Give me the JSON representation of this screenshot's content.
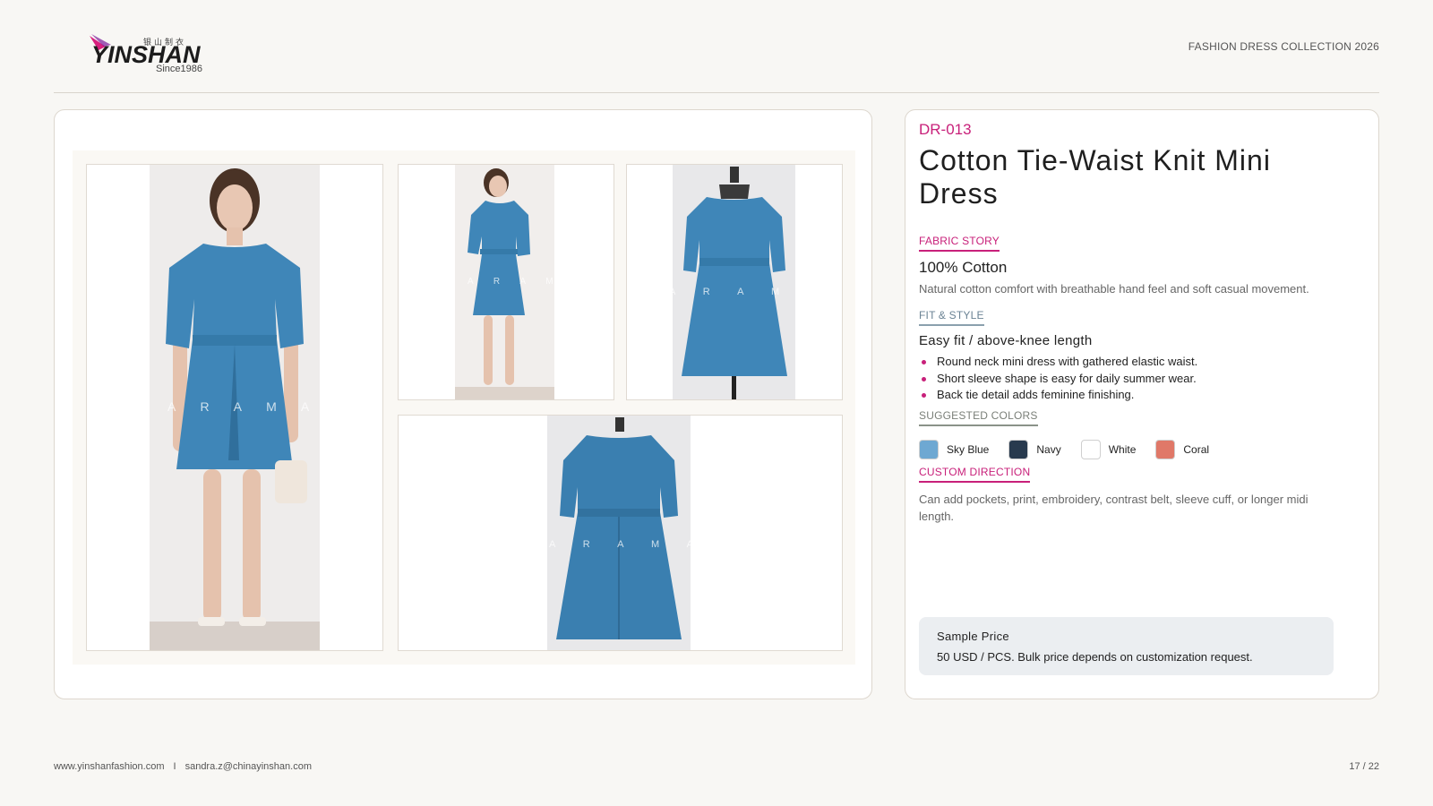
{
  "brand": {
    "chinese_name": "银山制衣",
    "wordmark": "YINSHAN",
    "since": "Since1986"
  },
  "header": {
    "collection": "FASHION DRESS COLLECTION 2026"
  },
  "gallery": {
    "watermark": "A R A M A R C",
    "photos": [
      {
        "view": "front-model"
      },
      {
        "view": "side-model"
      },
      {
        "view": "front-mannequin"
      },
      {
        "view": "back-mannequin"
      }
    ]
  },
  "product": {
    "code": "DR-013",
    "title": "Cotton Tie-Waist Knit Mini Dress",
    "fabric": {
      "label": "FABRIC STORY",
      "main": "100% Cotton",
      "desc": "Natural cotton comfort with breathable hand feel and soft casual movement."
    },
    "fit": {
      "label": "FIT & STYLE",
      "main": "Easy fit / above-knee length",
      "bullets": [
        "Round neck mini dress with gathered elastic waist.",
        "Short sleeve shape is easy for daily summer wear.",
        "Back tie detail adds feminine finishing."
      ]
    },
    "colors": {
      "label": "SUGGESTED COLORS",
      "items": [
        {
          "name": "Sky Blue",
          "hex": "#6ea8d2"
        },
        {
          "name": "Navy",
          "hex": "#283a4e"
        },
        {
          "name": "White",
          "hex": "#ffffff"
        },
        {
          "name": "Coral",
          "hex": "#e07868"
        }
      ]
    },
    "custom": {
      "label": "CUSTOM DIRECTION",
      "desc": "Can add pockets, print, embroidery, contrast belt, sleeve cuff, or longer midi length."
    },
    "price": {
      "label": "Sample Price",
      "text": "50 USD / PCS. Bulk price depends on customization request."
    }
  },
  "footer": {
    "website": "www.yinshanfashion.com",
    "separator": "I",
    "email": "sandra.z@chinayinshan.com",
    "page": "17 / 22"
  },
  "colors": {
    "accent": "#c8207a",
    "dress": "#3f86b8",
    "background": "#f8f7f4"
  }
}
